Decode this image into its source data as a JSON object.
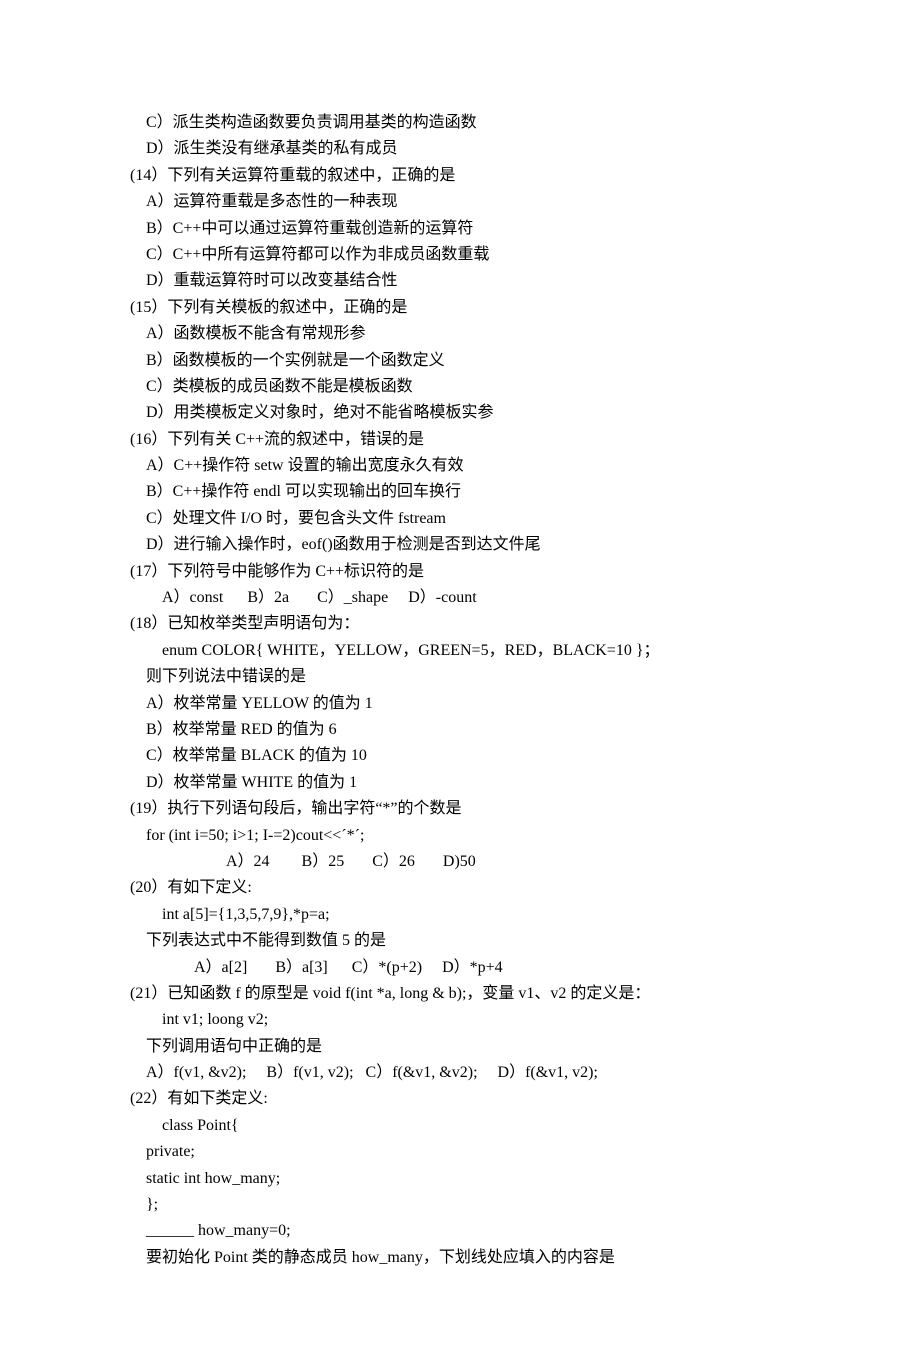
{
  "lines": [
    {
      "indent": "i1",
      "text": "C）派生类构造函数要负责调用基类的构造函数"
    },
    {
      "indent": "i1",
      "text": "D）派生类没有继承基类的私有成员"
    },
    {
      "indent": "",
      "text": "(14）下列有关运算符重载的叙述中，正确的是"
    },
    {
      "indent": "i1",
      "text": "A）运算符重载是多态性的一种表现"
    },
    {
      "indent": "i1",
      "text": "B）C++中可以通过运算符重载创造新的运算符"
    },
    {
      "indent": "i1",
      "text": "C）C++中所有运算符都可以作为非成员函数重载"
    },
    {
      "indent": "i1",
      "text": "D）重载运算符时可以改变基结合性"
    },
    {
      "indent": "",
      "text": "(15）下列有关模板的叙述中，正确的是"
    },
    {
      "indent": "i1",
      "text": "A）函数模板不能含有常规形参"
    },
    {
      "indent": "i1",
      "text": "B）函数模板的一个实例就是一个函数定义"
    },
    {
      "indent": "i1",
      "text": "C）类模板的成员函数不能是模板函数"
    },
    {
      "indent": "i1",
      "text": "D）用类模板定义对象时，绝对不能省略模板实参"
    },
    {
      "indent": "",
      "text": "(16）下列有关 C++流的叙述中，错误的是"
    },
    {
      "indent": "i1",
      "text": "A）C++操作符 setw 设置的输出宽度永久有效"
    },
    {
      "indent": "i1",
      "text": "B）C++操作符 endl 可以实现输出的回车换行"
    },
    {
      "indent": "i1",
      "text": "C）处理文件 I/O 时，要包含头文件 fstream"
    },
    {
      "indent": "i1",
      "text": "D）进行输入操作时，eof()函数用于检测是否到达文件尾"
    },
    {
      "indent": "",
      "text": "(17）下列符号中能够作为 C++标识符的是"
    },
    {
      "indent": "i2",
      "text": "A）const      B）2a       C）_shape     D）-count"
    },
    {
      "indent": "",
      "text": "(18）已知枚举类型声明语句为："
    },
    {
      "indent": "i2",
      "text": "enum COLOR{ WHITE，YELLOW，GREEN=5，RED，BLACK=10 }；"
    },
    {
      "indent": "i1",
      "text": "则下列说法中错误的是"
    },
    {
      "indent": "i1",
      "text": "A）枚举常量 YELLOW 的值为 1"
    },
    {
      "indent": "i1",
      "text": "B）枚举常量 RED 的值为 6"
    },
    {
      "indent": "i1",
      "text": "C）枚举常量 BLACK 的值为 10"
    },
    {
      "indent": "i1",
      "text": "D）枚举常量 WHITE 的值为 1"
    },
    {
      "indent": "",
      "text": "(19）执行下列语句段后，输出字符“*”的个数是"
    },
    {
      "indent": "i1",
      "text": "for (int i=50; i>1; I-=2)cout<<ˊ*ˊ;"
    },
    {
      "indent": "i6",
      "text": "A）24        B）25       C）26       D)50"
    },
    {
      "indent": "",
      "text": "(20）有如下定义:"
    },
    {
      "indent": "i2",
      "text": "int a[5]={1,3,5,7,9},*p=a;"
    },
    {
      "indent": "i1",
      "text": "下列表达式中不能得到数值 5 的是"
    },
    {
      "indent": "i4",
      "text": "A）a[2]       B）a[3]      C）*(p+2)     D）*p+4"
    },
    {
      "indent": "",
      "text": "(21）已知函数 f 的原型是 void f(int *a, long & b);，变量 v1、v2 的定义是："
    },
    {
      "indent": "i2",
      "text": "int v1; loong v2;"
    },
    {
      "indent": "i1",
      "text": "下列调用语句中正确的是"
    },
    {
      "indent": "i1",
      "text": "A）f(v1, &v2);     B）f(v1, v2);   C）f(&v1, &v2);     D）f(&v1, v2);"
    },
    {
      "indent": "",
      "text": "(22）有如下类定义:"
    },
    {
      "indent": "i2",
      "text": "class Point{"
    },
    {
      "indent": "i1",
      "text": "private;"
    },
    {
      "indent": "i1",
      "text": "static int how_many;"
    },
    {
      "indent": "i1",
      "text": "};"
    },
    {
      "indent": "i1",
      "text": "______ how_many=0;"
    },
    {
      "indent": "i1",
      "text": "要初始化 Point 类的静态成员 how_many，下划线处应填入的内容是"
    }
  ]
}
